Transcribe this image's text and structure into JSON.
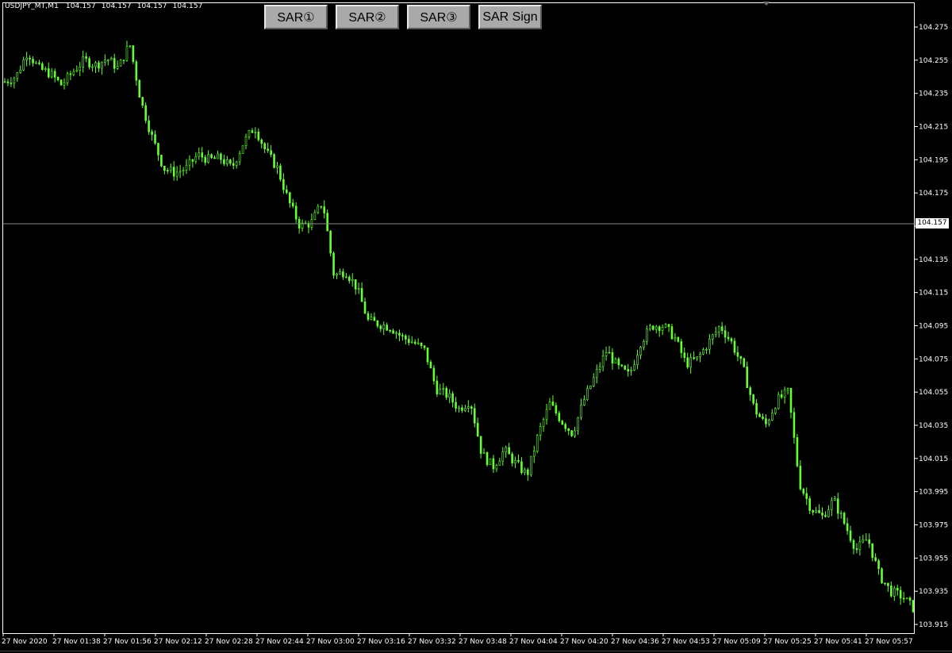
{
  "chart_header": {
    "symbol": "USDJPY_MT,M1",
    "open": "104.157",
    "high": "104.157",
    "low": "104.157",
    "close": "104.157"
  },
  "buttons": {
    "sar1": "SAR①",
    "sar2": "SAR②",
    "sar3": "SAR③",
    "sar_sign": "SAR Sign"
  },
  "price_scale": {
    "ticks": [
      "104.275",
      "104.255",
      "104.235",
      "104.215",
      "104.195",
      "104.175",
      "104.155",
      "104.135",
      "104.115",
      "104.095",
      "104.075",
      "104.055",
      "104.035",
      "104.015",
      "103.995",
      "103.975",
      "103.955",
      "103.935",
      "103.915"
    ],
    "current_price": "104.157"
  },
  "time_scale": {
    "labels": [
      "27 Nov 2020",
      "27 Nov 01:38",
      "27 Nov 01:56",
      "27 Nov 02:12",
      "27 Nov 02:28",
      "27 Nov 02:44",
      "27 Nov 03:00",
      "27 Nov 03:16",
      "27 Nov 03:32",
      "27 Nov 03:48",
      "27 Nov 04:04",
      "27 Nov 04:20",
      "27 Nov 04:36",
      "27 Nov 04:53",
      "27 Nov 05:09",
      "27 Nov 05:25",
      "27 Nov 05:41",
      "27 Nov 05:57"
    ]
  },
  "colors": {
    "background": "#000000",
    "candle": "#66ff33",
    "axis": "#ffffff",
    "current_price_line": "#808080"
  },
  "chart_data": {
    "type": "line",
    "title": "USDJPY_MT,M1",
    "xlabel": "",
    "ylabel": "",
    "ylim": [
      103.912,
      104.283
    ],
    "series": [
      {
        "values": [
          104.242,
          104.245,
          104.26,
          104.25,
          104.247,
          104.24,
          104.248,
          104.255,
          104.252,
          104.256,
          104.25,
          104.265,
          104.23,
          104.208,
          104.19,
          104.187,
          104.19,
          104.198,
          104.195,
          104.196,
          104.19,
          104.205,
          104.215,
          104.2,
          104.19,
          104.17,
          104.155,
          104.157,
          104.17,
          104.125,
          104.128,
          104.118,
          104.098,
          104.096,
          104.094,
          104.088,
          104.085,
          104.08,
          104.057,
          104.053,
          104.045,
          104.05,
          104.018,
          104.01,
          104.02,
          104.012,
          104.005,
          104.03,
          104.048,
          104.038,
          104.03,
          104.05,
          104.065,
          104.08,
          104.07,
          104.065,
          104.085,
          104.095,
          104.095,
          104.088,
          104.072,
          104.075,
          104.085,
          104.095,
          104.085,
          104.07,
          104.045,
          104.035,
          104.05,
          104.055,
          104.0,
          103.985,
          103.98,
          103.99,
          103.975,
          103.96,
          103.967,
          103.945,
          103.935,
          103.932,
          103.925
        ]
      }
    ]
  }
}
